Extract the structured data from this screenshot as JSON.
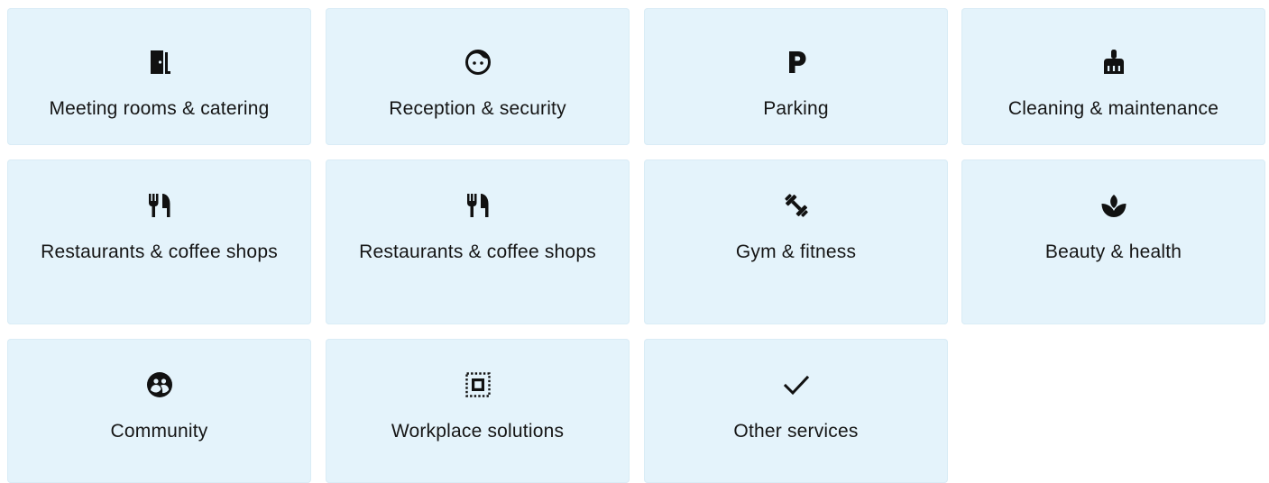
{
  "services": {
    "tiles": [
      {
        "label": "Meeting rooms & catering",
        "icon": "door-icon"
      },
      {
        "label": "Reception & security",
        "icon": "face-icon"
      },
      {
        "label": "Parking",
        "icon": "parking-icon"
      },
      {
        "label": "Cleaning & maintenance",
        "icon": "broom-icon"
      },
      {
        "label": "Restaurants & coffee shops",
        "icon": "cutlery-icon"
      },
      {
        "label": "Restaurants & coffee shops",
        "icon": "cutlery-icon"
      },
      {
        "label": "Gym & fitness",
        "icon": "dumbbell-icon"
      },
      {
        "label": "Beauty & health",
        "icon": "spa-icon"
      },
      {
        "label": "Community",
        "icon": "community-icon"
      },
      {
        "label": "Workplace solutions",
        "icon": "select-area-icon"
      },
      {
        "label": "Other services",
        "icon": "check-icon"
      }
    ]
  },
  "colors": {
    "tile_background": "#e4f3fb",
    "text": "#151515",
    "icon": "#111111"
  }
}
